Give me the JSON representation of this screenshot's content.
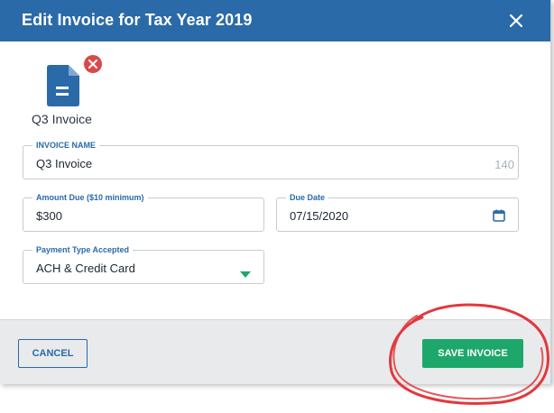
{
  "dialog": {
    "title": "Edit Invoice for Tax Year 2019",
    "close_icon": "close-icon"
  },
  "attachment": {
    "icon": "document-icon",
    "remove_icon": "remove-icon",
    "file_name": "Q3 Invoice"
  },
  "form": {
    "invoice_name": {
      "label": "INVOICE NAME",
      "value": "Q3 Invoice",
      "char_count": "140"
    },
    "amount_due": {
      "label": "Amount Due ($10 minimum)",
      "value": "$300"
    },
    "due_date": {
      "label": "Due Date",
      "value": "07/15/2020",
      "icon": "calendar-icon"
    },
    "payment_type": {
      "label": "Payment Type Accepted",
      "value": "ACH & Credit Card",
      "icon": "caret-down-icon"
    }
  },
  "footer": {
    "cancel_label": "CANCEL",
    "save_label": "SAVE INVOICE"
  },
  "colors": {
    "header": "#2a6aa8",
    "primary_action": "#1ea76a",
    "remove_badge": "#d9494a",
    "annotation_circle": "#e2383c"
  }
}
